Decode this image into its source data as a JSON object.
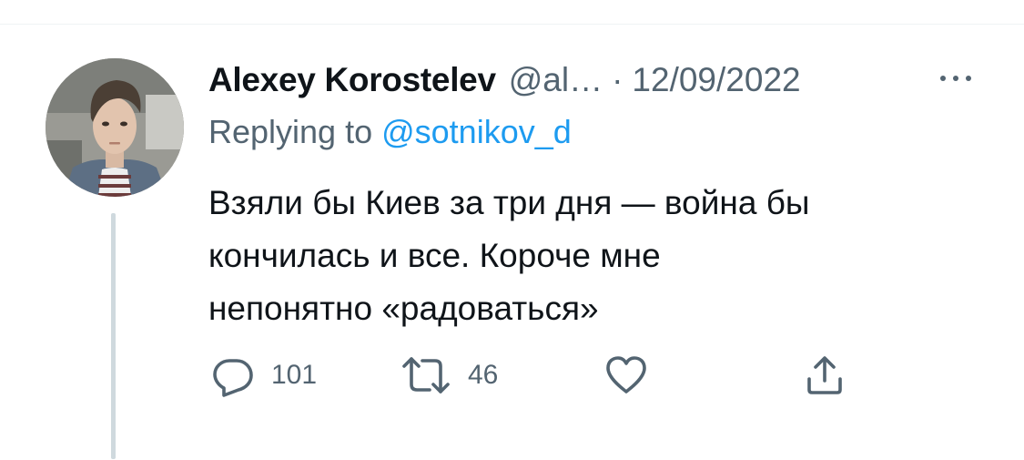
{
  "tweet": {
    "author": {
      "display_name": "Alexey Korostelev",
      "handle": "@al…"
    },
    "separator": "·",
    "date": "12/09/2022",
    "reply_context": {
      "prefix": "Replying to ",
      "mention": "@sotnikov_d"
    },
    "text_lines": [
      "Взяли бы Киев за три дня — война бы",
      "кончилась и все. Короче мне",
      "непонятно «радоваться»"
    ],
    "actions": {
      "reply": {
        "icon": "reply-icon",
        "count": "101"
      },
      "retweet": {
        "icon": "retweet-icon",
        "count": "46"
      },
      "like": {
        "icon": "heart-icon"
      },
      "share": {
        "icon": "share-icon"
      }
    }
  },
  "colors": {
    "text_primary": "#0f1419",
    "text_secondary": "#536471",
    "accent": "#1d9bf0",
    "thread_line": "#cfd9de"
  }
}
